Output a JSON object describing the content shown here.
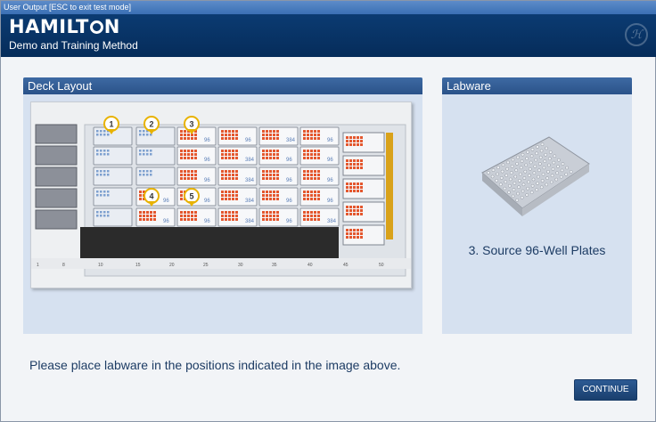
{
  "window": {
    "title": "User Output [ESC to exit test mode]"
  },
  "header": {
    "brand": "HAMILTON",
    "brand_before_o": "HAMILT",
    "brand_after_o": "N",
    "subtitle": "Demo and Training Method"
  },
  "deck_panel": {
    "title": "Deck Layout",
    "positions": [
      "1",
      "2",
      "3",
      "4",
      "5"
    ],
    "plate_labels": [
      "96",
      "96",
      "96",
      "96",
      "96",
      "96",
      "96",
      "96",
      "384",
      "384",
      "384",
      "384",
      "384"
    ],
    "ruler_ticks": [
      "1",
      "8",
      "10",
      "15",
      "20",
      "25",
      "30",
      "35",
      "40",
      "45",
      "50"
    ]
  },
  "labware_panel": {
    "title": "Labware",
    "caption": "3. Source 96-Well Plates"
  },
  "instruction": "Please place labware in the positions indicated in the image above.",
  "buttons": {
    "continue_label": "CONTINUE"
  },
  "colors": {
    "header_bg": "#0b3b72",
    "panel_bg": "#d6e1f0",
    "panel_head": "#2f5a93",
    "marker": "#e8b200",
    "plate_orange": "#e4572e"
  }
}
